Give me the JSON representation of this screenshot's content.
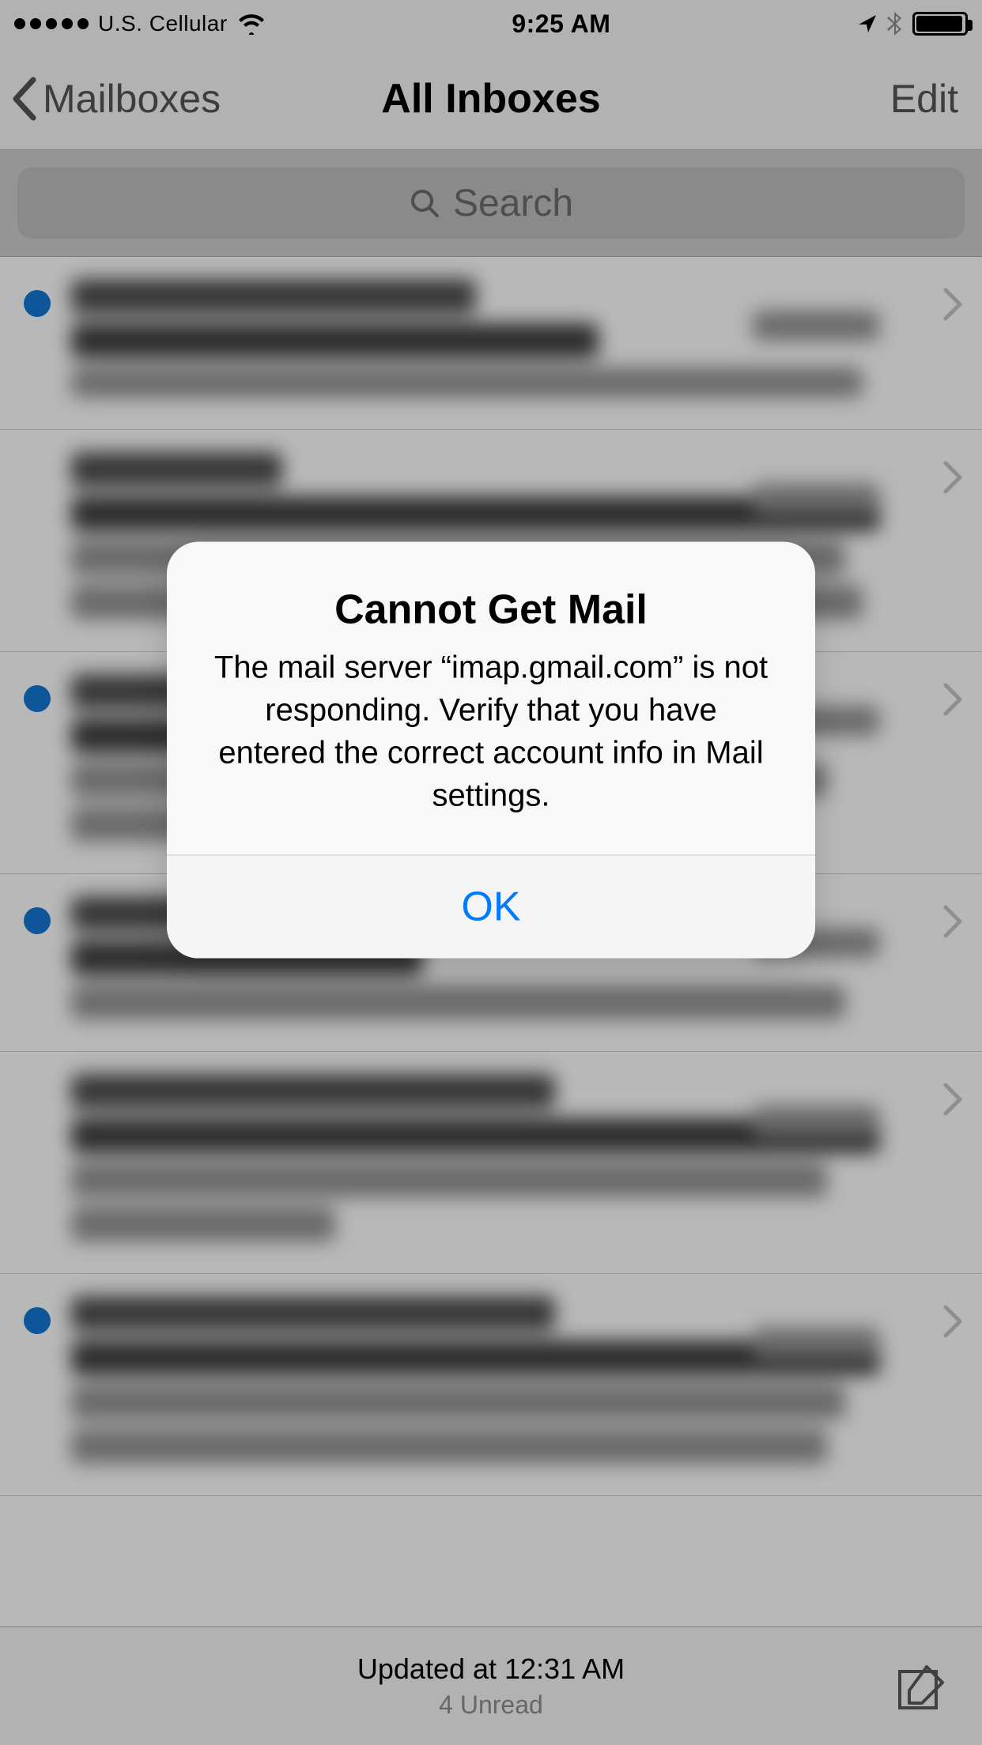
{
  "status": {
    "carrier": "U.S. Cellular",
    "time": "9:25 AM"
  },
  "nav": {
    "back_label": "Mailboxes",
    "title": "All Inboxes",
    "edit_label": "Edit"
  },
  "search": {
    "placeholder": "Search"
  },
  "footer": {
    "updated": "Updated at 12:31 AM",
    "unread": "4 Unread"
  },
  "alert": {
    "title": "Cannot Get Mail",
    "message": "The mail server “imap.gmail.com” is not responding. Verify that you have entered the correct account info in Mail settings.",
    "ok_label": "OK"
  }
}
